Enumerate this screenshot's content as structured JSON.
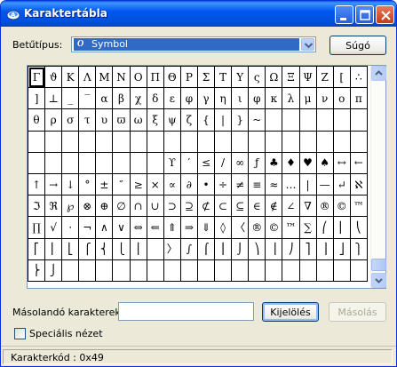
{
  "window": {
    "title": "Karaktertábla",
    "title_icon": "charmap-app-icon",
    "controls": [
      "minimize-icon",
      "maximize-icon",
      "close-icon"
    ]
  },
  "font_row": {
    "label": "Betűtípus:",
    "selected_font": "Symbol",
    "font_type_glyph": "O",
    "help_button": "Súgó"
  },
  "grid": {
    "selected_char": "Γ",
    "rows": [
      [
        "Γ",
        "ϑ",
        "Κ",
        "Λ",
        "Μ",
        "Ν",
        "Ο",
        "Π",
        "Θ",
        "Ρ",
        "Σ",
        "Τ",
        "Υ",
        "ς",
        "Ω",
        "Ξ",
        "Ψ",
        "Ζ",
        "[",
        "∴"
      ],
      [
        "]",
        "⊥",
        "_",
        "‾",
        "α",
        "β",
        "χ",
        "δ",
        "ε",
        "φ",
        "γ",
        "η",
        "ι",
        "φ",
        "κ",
        "λ",
        "μ",
        "ν",
        "ο",
        "π"
      ],
      [
        "θ",
        "ρ",
        "σ",
        "τ",
        "υ",
        "ϖ",
        "ω",
        "ξ",
        "ψ",
        "ζ",
        "{",
        "|",
        "}",
        "~",
        "",
        "",
        "",
        "",
        "",
        ""
      ],
      [
        "",
        "",
        "",
        "",
        "",
        "",
        "",
        "",
        "",
        "",
        "",
        "",
        "",
        "",
        "",
        "",
        "",
        "",
        "",
        ""
      ],
      [
        "",
        "",
        "",
        "",
        "",
        "",
        "",
        "",
        "ϒ",
        "′",
        "≤",
        "/",
        "∞",
        "ƒ",
        "♣",
        "♦",
        "♥",
        "♠",
        "↔",
        "←"
      ],
      [
        "↑",
        "→",
        "↓",
        "°",
        "±",
        "″",
        "≥",
        "×",
        "∝",
        "∂",
        "•",
        "÷",
        "≠",
        "≡",
        "≈",
        "…",
        "|",
        "—",
        "↵",
        "ℵ"
      ],
      [
        "ℑ",
        "ℜ",
        "℘",
        "⊗",
        "⊕",
        "∅",
        "∩",
        "∪",
        "⊃",
        "⊇",
        "⊄",
        "⊂",
        "⊆",
        "∈",
        "∉",
        "∠",
        "∇",
        "®",
        "©",
        "™"
      ],
      [
        "∏",
        "√",
        "⋅",
        "¬",
        "∧",
        "∨",
        "⇔",
        "⇐",
        "⇑",
        "⇒",
        "⇓",
        "◊",
        "〈",
        "®",
        "©",
        "™",
        "∑",
        "⎛",
        "⎜",
        "⎝"
      ],
      [
        "⎡",
        "⎢",
        "⎣",
        "⎧",
        "⎨",
        "⎩",
        "⎪",
        "",
        "〉",
        "∫",
        "⌠",
        "⎮",
        "⌡",
        "⎞",
        "⎟",
        "⎠",
        "⎤",
        "⎥",
        "⎦",
        "⎫"
      ],
      [
        "⎬",
        "⎭",
        "",
        "",
        "",
        "",
        "",
        "",
        "",
        "",
        "",
        "",
        "",
        "",
        "",
        "",
        "",
        "",
        "",
        ""
      ]
    ]
  },
  "copy_row": {
    "label": "Másolandó karakterek:",
    "value": "",
    "select_button": "Kijelölés",
    "copy_button": "Másolás"
  },
  "advanced": {
    "label": "Speciális nézet",
    "checked": false
  },
  "status": {
    "text": "Karakterkód : 0x49"
  }
}
